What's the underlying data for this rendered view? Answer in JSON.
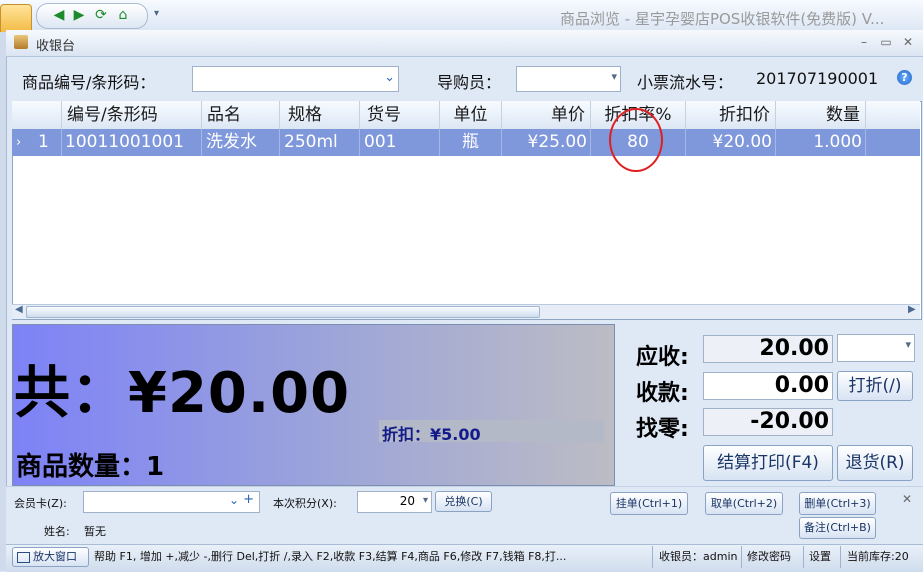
{
  "app": {
    "title": "商品浏览 - 星宇孕婴店POS收银软件(免费版) V...",
    "window_title": "收银台"
  },
  "search": {
    "code_label": "商品编号/条形码：",
    "code_value": "",
    "guide_label": "导购员：",
    "guide_value": "",
    "ticket_label": "小票流水号：",
    "ticket_value": "201707190001"
  },
  "grid": {
    "columns": [
      "编号/条形码",
      "品名",
      "规格",
      "货号",
      "单位",
      "单价",
      "折扣率%",
      "折扣价",
      "数量"
    ],
    "rows": [
      {
        "index": "1",
        "code": "10011001001",
        "name": "洗发水",
        "spec": "250ml",
        "item_no": "001",
        "unit": "瓶",
        "price": "¥25.00",
        "discount_rate": "80",
        "discount_price": "¥20.00",
        "qty": "1.000"
      }
    ]
  },
  "totals": {
    "total_text": "共：¥20.00",
    "discount_text": "折扣：¥5.00",
    "qty_text": "商品数量：1"
  },
  "payment": {
    "receivable_label": "应收:",
    "receivable_value": "20.00",
    "received_label": "收款:",
    "received_value": "0.00",
    "change_label": "找零:",
    "change_value": "-20.00",
    "discount_button": "打折(/)",
    "checkout_button": "结算打印(F4)",
    "return_button": "退货(R)"
  },
  "member": {
    "card_label": "会员卡(Z):",
    "card_value": "",
    "points_label": "本次积分(X):",
    "points_value": "20",
    "exchange_button": "兑换(C)",
    "name_label": "姓名:",
    "name_value": "暂无",
    "hold_button": "挂单(Ctrl+1)",
    "retrieve_button": "取单(Ctrl+2)",
    "delete_button": "删单(Ctrl+3)",
    "note_button": "备注(Ctrl+B)"
  },
  "statusbar": {
    "enlarge_button": "放大窗口",
    "help_text": "帮助 F1, 增加 +,减少 -,删行 Del,打折 /,录入 F2,收款 F3,结算 F4,商品 F6,修改 F7,钱箱 F8,打...",
    "cashier_text": "收银员：admin",
    "change_password": "修改密码",
    "settings": "设置",
    "stock_text": "当前库存:20"
  },
  "colors": {
    "selected_row": "#7f97db",
    "highlight_circle": "#e02020",
    "panel_gradient_start": "#7d82f7"
  }
}
